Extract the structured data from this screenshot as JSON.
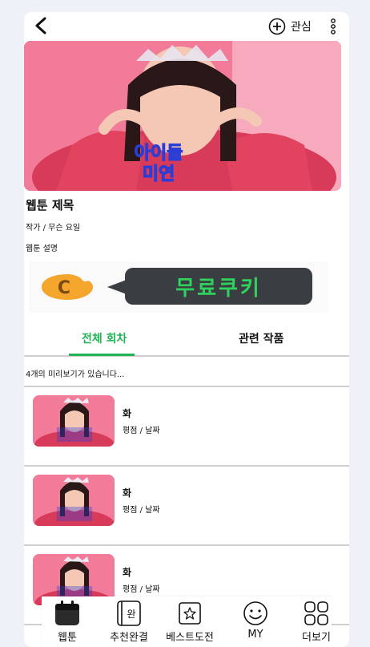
{
  "header": {
    "back_icon": "chevron-left-icon",
    "favorite_icon": "plus-circle-icon",
    "favorite_label": "관심",
    "more_icon": "more-vertical-icon"
  },
  "hero": {
    "image": "webtoon-cover-image",
    "cover_text_line1": "아이들",
    "cover_text_line2": "미연"
  },
  "webtoon": {
    "title": "웹툰 제목",
    "meta": "작가 / 무슨 요일",
    "description": "웹툰 설명"
  },
  "banner": {
    "icon": "cookie-icon",
    "text": "무료쿠키",
    "text_color": "#2fd35b",
    "bubble_color": "#3a3d42"
  },
  "tabs": [
    {
      "label": "전체 회차",
      "active": true
    },
    {
      "label": "관련 작품",
      "active": false
    }
  ],
  "accent_color": "#21b356",
  "preview_info": "4개의 미리보기가 있습니다...",
  "episodes": [
    {
      "title": "화",
      "subtitle": "평점 / 날짜"
    },
    {
      "title": "화",
      "subtitle": "평점 / 날짜"
    },
    {
      "title": "화",
      "subtitle": "평점 / 날짜"
    }
  ],
  "bottom_nav": [
    {
      "label": "웹툰",
      "icon": "calendar-icon",
      "active": true
    },
    {
      "label": "추천완결",
      "icon": "completed-book-icon",
      "badge": "완",
      "active": false
    },
    {
      "label": "베스트도전",
      "icon": "star-square-icon",
      "active": false
    },
    {
      "label": "MY",
      "icon": "smiley-icon",
      "active": false
    },
    {
      "label": "더보기",
      "icon": "grid-icon",
      "active": false
    }
  ]
}
